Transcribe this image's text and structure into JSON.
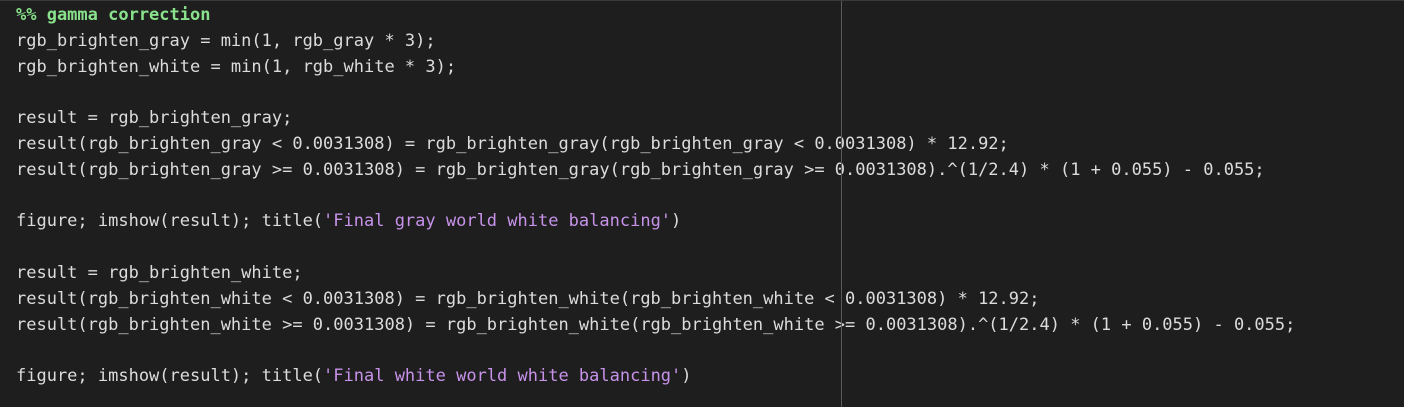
{
  "editor": {
    "lines": [
      {
        "segments": [
          {
            "type": "comment",
            "text": "%% gamma correction"
          }
        ]
      },
      {
        "segments": [
          {
            "type": "code",
            "text": "rgb_brighten_gray = min(1, rgb_gray * 3);"
          }
        ]
      },
      {
        "segments": [
          {
            "type": "code",
            "text": "rgb_brighten_white = min(1, rgb_white * 3);"
          }
        ]
      },
      {
        "segments": []
      },
      {
        "segments": [
          {
            "type": "code",
            "text": "result = rgb_brighten_gray;"
          }
        ]
      },
      {
        "segments": [
          {
            "type": "code",
            "text": "result(rgb_brighten_gray < 0.0031308) = rgb_brighten_gray(rgb_brighten_gray < 0.0031308) * 12.92;"
          }
        ]
      },
      {
        "segments": [
          {
            "type": "code",
            "text": "result(rgb_brighten_gray >= 0.0031308) = rgb_brighten_gray(rgb_brighten_gray >= 0.0031308).^(1/2.4) * (1 + 0.055) - 0.055;"
          }
        ]
      },
      {
        "segments": []
      },
      {
        "segments": [
          {
            "type": "code",
            "text": "figure; imshow(result); title("
          },
          {
            "type": "string",
            "text": "'Final gray world white balancing'"
          },
          {
            "type": "code",
            "text": ")"
          }
        ]
      },
      {
        "segments": []
      },
      {
        "segments": [
          {
            "type": "code",
            "text": "result = rgb_brighten_white;"
          }
        ]
      },
      {
        "segments": [
          {
            "type": "code",
            "text": "result(rgb_brighten_white < 0.0031308) = rgb_brighten_white(rgb_brighten_white < 0.0031308) * 12.92;"
          }
        ]
      },
      {
        "segments": [
          {
            "type": "code",
            "text": "result(rgb_brighten_white >= 0.0031308) = rgb_brighten_white(rgb_brighten_white >= 0.0031308).^(1/2.4) * (1 + 0.055) - 0.055;"
          }
        ]
      },
      {
        "segments": []
      },
      {
        "segments": [
          {
            "type": "code",
            "text": "figure; imshow(result); title("
          },
          {
            "type": "string",
            "text": "'Final white world white balancing'"
          },
          {
            "type": "code",
            "text": ")"
          }
        ]
      }
    ]
  },
  "colors": {
    "background": "#1e1e1e",
    "code_text": "#dcdcdc",
    "comment": "#89e28b",
    "string": "#c792ea",
    "ruler": "#5a5a5a"
  }
}
